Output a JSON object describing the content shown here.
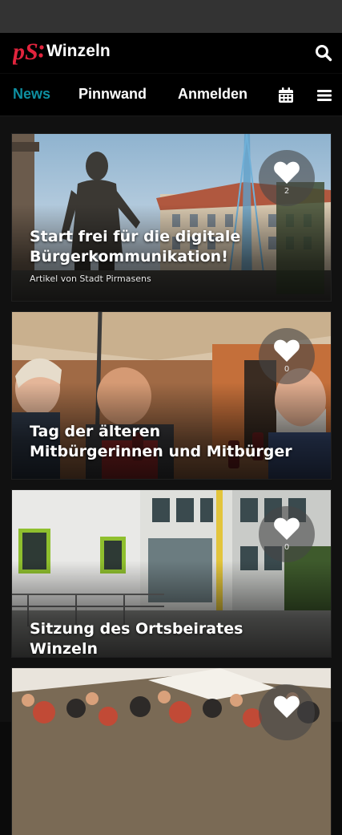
{
  "app": {
    "logo_mark": "pS:",
    "logo_text": "Winzeln"
  },
  "icons": {
    "search": "search-icon",
    "calendar": "calendar-icon",
    "menu": "hamburger-menu-icon",
    "like": "heart-icon"
  },
  "colors": {
    "accent": "#0e8fa1",
    "brand_red": "#e2243d",
    "background": "#000000"
  },
  "nav": {
    "tabs": [
      {
        "label": "News",
        "active": true
      },
      {
        "label": "Pinnwand",
        "active": false
      },
      {
        "label": "Anmelden",
        "active": false
      }
    ]
  },
  "feed": {
    "cards": [
      {
        "title": "Start frei für die digitale Bürgerkommunikation!",
        "subtitle": "Artikel von Stadt Pirmasens",
        "likes": "2"
      },
      {
        "title": "Tag der älteren Mitbürgerinnen und Mitbürger",
        "subtitle": "",
        "likes": "0"
      },
      {
        "title": "Sitzung des Ortsbeirates Winzeln",
        "subtitle": "",
        "likes": "0"
      },
      {
        "title": "",
        "subtitle": "",
        "likes": ""
      }
    ]
  }
}
